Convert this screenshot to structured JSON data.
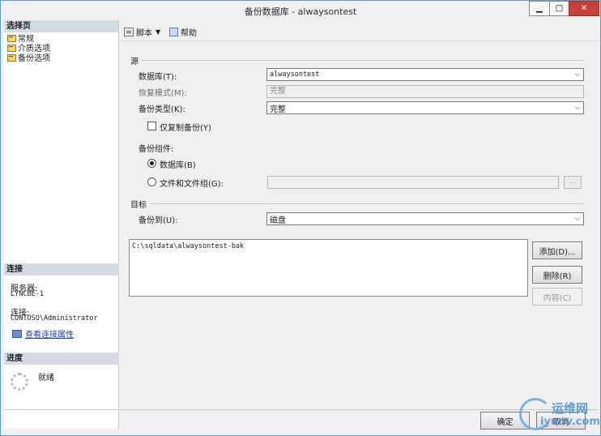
{
  "window": {
    "title": "备份数据库 - alwaysontest",
    "min_glyph": "▁",
    "max_glyph": "□",
    "close_glyph": "✕"
  },
  "left": {
    "select_page_header": "选择页",
    "pages": [
      {
        "label": "常规"
      },
      {
        "label": "介质选项"
      },
      {
        "label": "备份选项"
      }
    ],
    "connection_header": "连接",
    "server_label": "服务器:",
    "server_value": "LYNCBE-1",
    "connection_label": "连接:",
    "connection_value": "CONTOSO\\Administrator",
    "view_connection_link": "查看连接属性",
    "progress_header": "进度",
    "progress_status": "就绪"
  },
  "toolbar": {
    "script_label": "脚本",
    "help_label": "帮助"
  },
  "source": {
    "group_label": "源",
    "database_label": "数据库(T):",
    "database_value": "alwaysontest",
    "recovery_label": "恢复模式(M):",
    "recovery_value": "完整",
    "backup_type_label": "备份类型(K):",
    "backup_type_value": "完整",
    "copy_only_label": "仅复制备份(Y)",
    "component_label": "备份组件:",
    "radio_database_label": "数据库(B)",
    "radio_files_label": "文件和文件组(G):",
    "dots_label": "..."
  },
  "destination": {
    "group_label": "目标",
    "backup_to_label": "备份到(U):",
    "backup_to_value": "磁盘",
    "paths": [
      "C:\\sqldata\\alwaysontest-bak"
    ],
    "add_label": "添加(D)...",
    "remove_label": "删除(R)",
    "contents_label": "内容(C)"
  },
  "footer": {
    "ok_label": "确定",
    "cancel_label": "取消"
  },
  "watermark": {
    "line1": "运维网",
    "line2": "iyunv.com"
  }
}
